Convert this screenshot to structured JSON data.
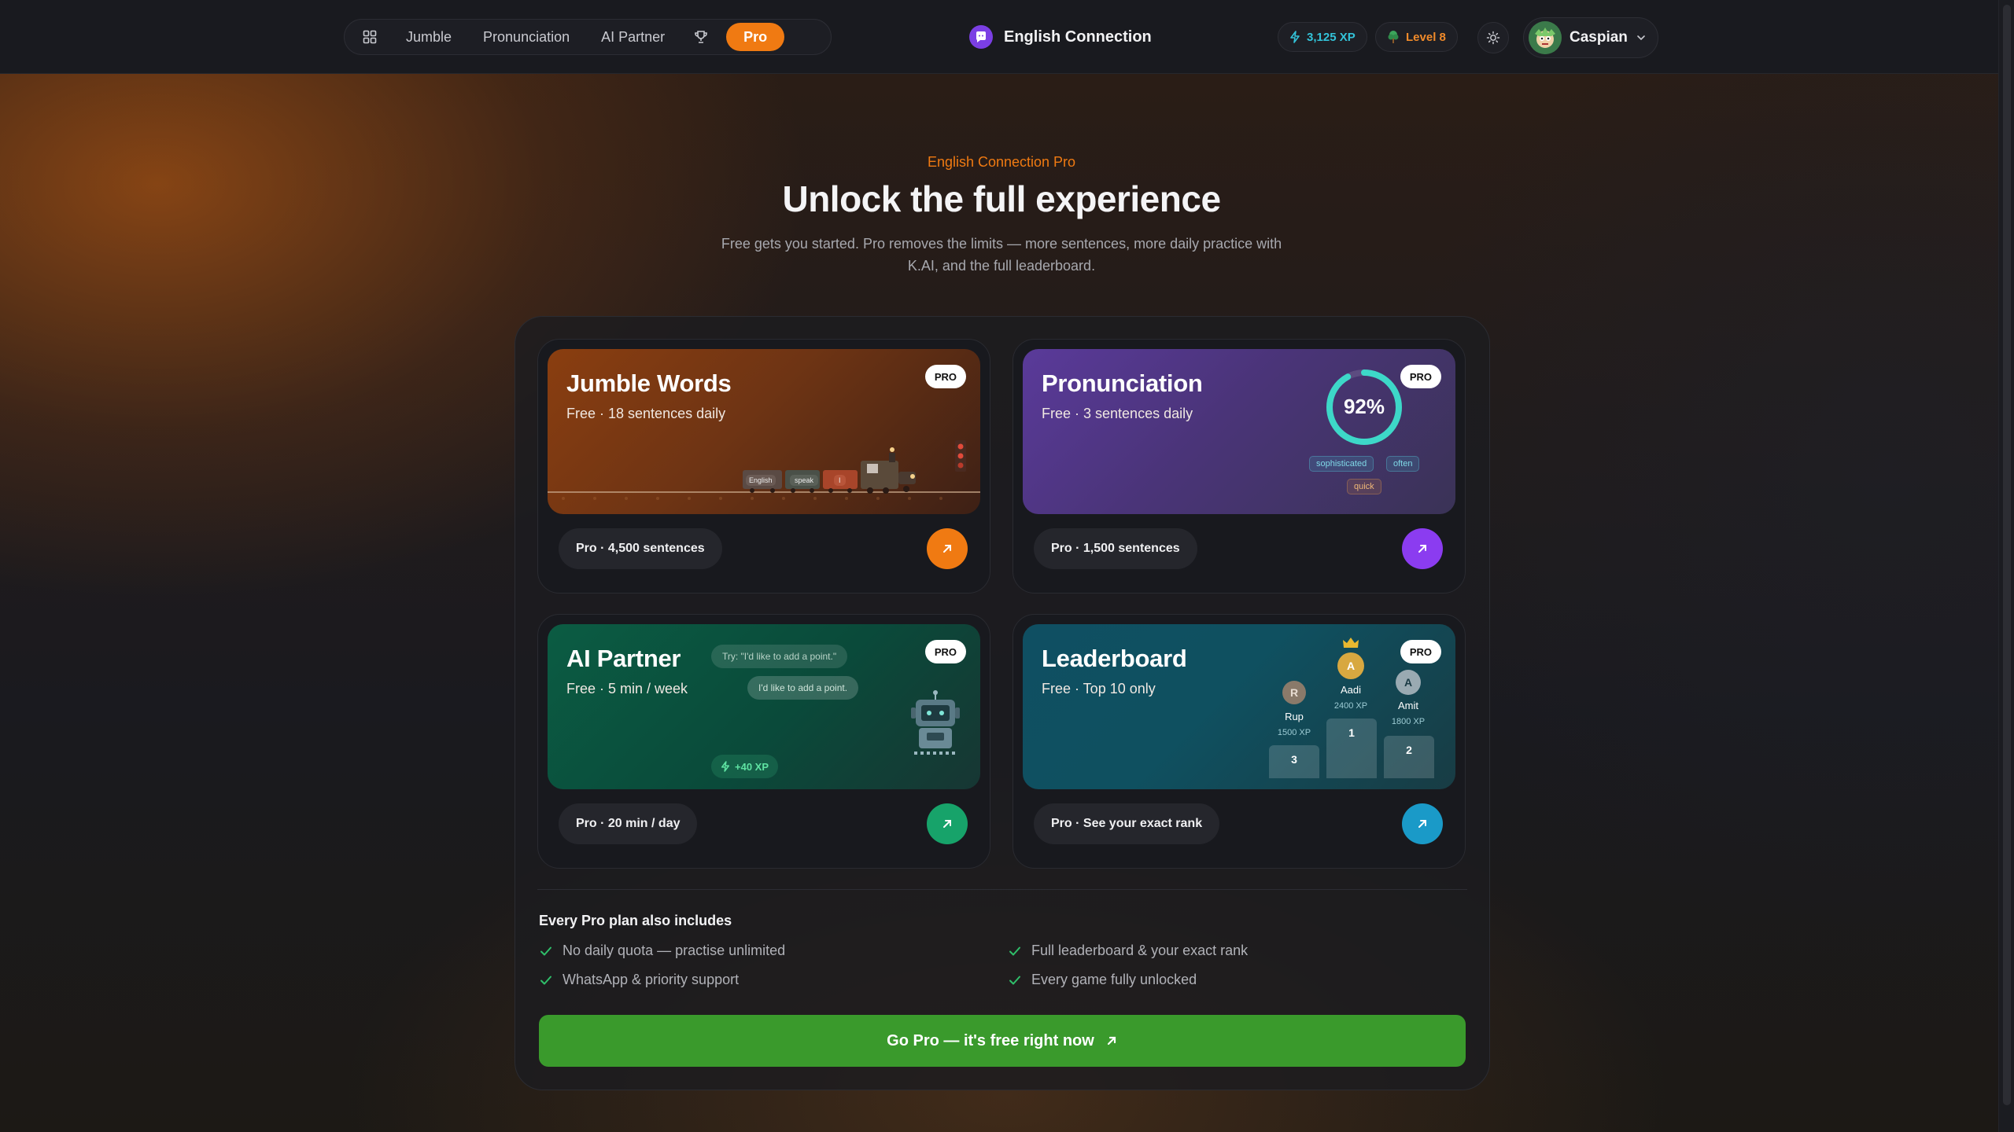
{
  "nav": {
    "items": [
      "Jumble",
      "Pronunciation",
      "AI Partner"
    ],
    "pro_label": "Pro"
  },
  "brand": {
    "name": "English Connection"
  },
  "stats": {
    "xp": "3,125 XP",
    "level": "Level 8"
  },
  "user": {
    "name": "Caspian"
  },
  "hero": {
    "eyebrow": "English Connection Pro",
    "title": "Unlock the full experience",
    "subtitle": "Free gets you started. Pro removes the limits — more sentences, more daily practice with K.AI, and the full leaderboard."
  },
  "cards": {
    "jumble": {
      "title": "Jumble Words",
      "free": "Free · 18 sentences daily",
      "badge": "PRO",
      "pro": "Pro · 4,500 sentences",
      "wagons": [
        "English",
        "speak",
        "I"
      ],
      "accent": "#f07a12"
    },
    "pron": {
      "title": "Pronunciation",
      "free": "Free · 3 sentences daily",
      "badge": "PRO",
      "score": "92%",
      "score_value": 0.92,
      "words": [
        "sophisticated",
        "often",
        "quick"
      ],
      "pro": "Pro · 1,500 sentences",
      "accent": "#8b3cf0"
    },
    "ai": {
      "title": "AI Partner",
      "free": "Free · 5 min / week",
      "badge": "PRO",
      "bubble1": "Try: \"I'd like to add a point.\"",
      "bubble2": "I'd like to add a point.",
      "xp": "+40 XP",
      "pro": "Pro · 20 min / day",
      "accent": "#17a36a"
    },
    "lead": {
      "title": "Leaderboard",
      "free": "Free · Top 10 only",
      "badge": "PRO",
      "podium": [
        {
          "initial": "R",
          "name": "Rup",
          "xp": "1500 XP",
          "rank": "3"
        },
        {
          "initial": "A",
          "name": "Aadi",
          "xp": "2400 XP",
          "rank": "1"
        },
        {
          "initial": "A",
          "name": "Amit",
          "xp": "1800 XP",
          "rank": "2"
        }
      ],
      "pro": "Pro · See your exact rank",
      "accent": "#1a9ac8"
    }
  },
  "includes": {
    "title": "Every Pro plan also includes",
    "items": [
      "No daily quota — practise unlimited",
      "Full leaderboard & your exact rank",
      "WhatsApp & priority support",
      "Every game fully unlocked"
    ]
  },
  "cta": {
    "label": "Go Pro — it's free right now"
  }
}
